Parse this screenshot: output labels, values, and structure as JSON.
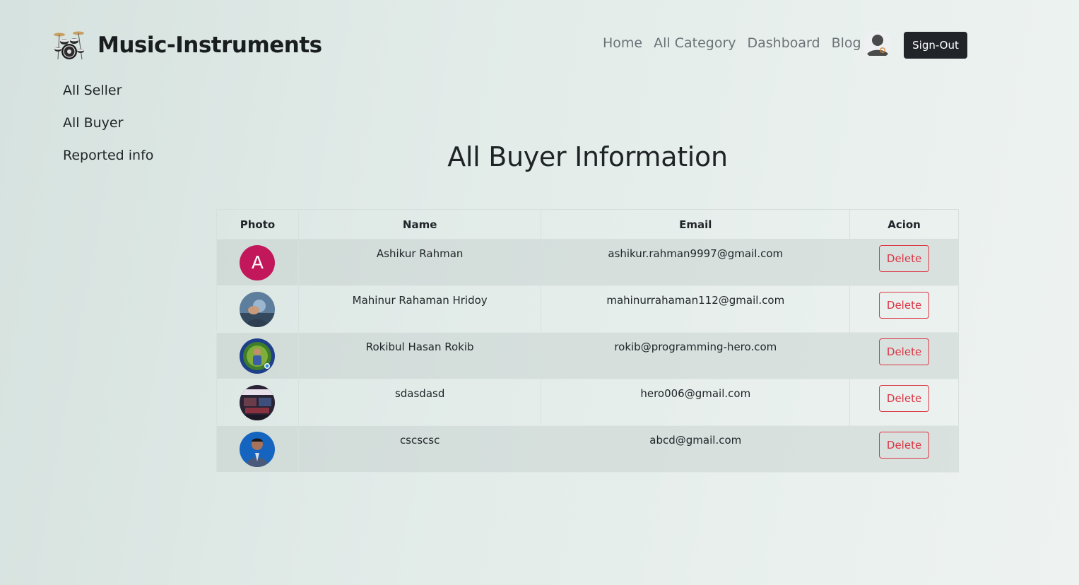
{
  "brand": {
    "title": "Music-Instruments",
    "logo_icon": "drum-kit-icon"
  },
  "nav": {
    "links": [
      "Home",
      "All Category",
      "Dashboard",
      "Blog"
    ],
    "profile_icon": "user-avatar-icon",
    "signout_label": "Sign-Out"
  },
  "sidebar": {
    "items": [
      "All Seller",
      "All Buyer",
      "Reported info"
    ]
  },
  "main": {
    "title": "All Buyer Information",
    "table": {
      "headers": [
        "Photo",
        "Name",
        "Email",
        "Acion"
      ],
      "rows": [
        {
          "avatar_letter": "A",
          "avatar_icon": "letter-avatar",
          "name": "Ashikur Rahman",
          "email": "ashikur.rahman9997@gmail.com",
          "action": "Delete"
        },
        {
          "avatar_letter": "",
          "avatar_icon": "photo-avatar",
          "name": "Mahinur Rahaman Hridoy",
          "email": "mahinurrahaman112@gmail.com",
          "action": "Delete"
        },
        {
          "avatar_letter": "",
          "avatar_icon": "photo-avatar",
          "name": "Rokibul Hasan Rokib",
          "email": "rokib@programming-hero.com",
          "action": "Delete"
        },
        {
          "avatar_letter": "",
          "avatar_icon": "photo-avatar",
          "name": "sdasdasd",
          "email": "hero006@gmail.com",
          "action": "Delete"
        },
        {
          "avatar_letter": "",
          "avatar_icon": "photo-avatar",
          "name": "cscscsc",
          "email": "abcd@gmail.com",
          "action": "Delete"
        }
      ]
    }
  },
  "colors": {
    "brand_dark": "#212529",
    "danger": "#dc3545",
    "letter_avatar_bg": "#c2185b",
    "nav_link": "#6c7177"
  }
}
